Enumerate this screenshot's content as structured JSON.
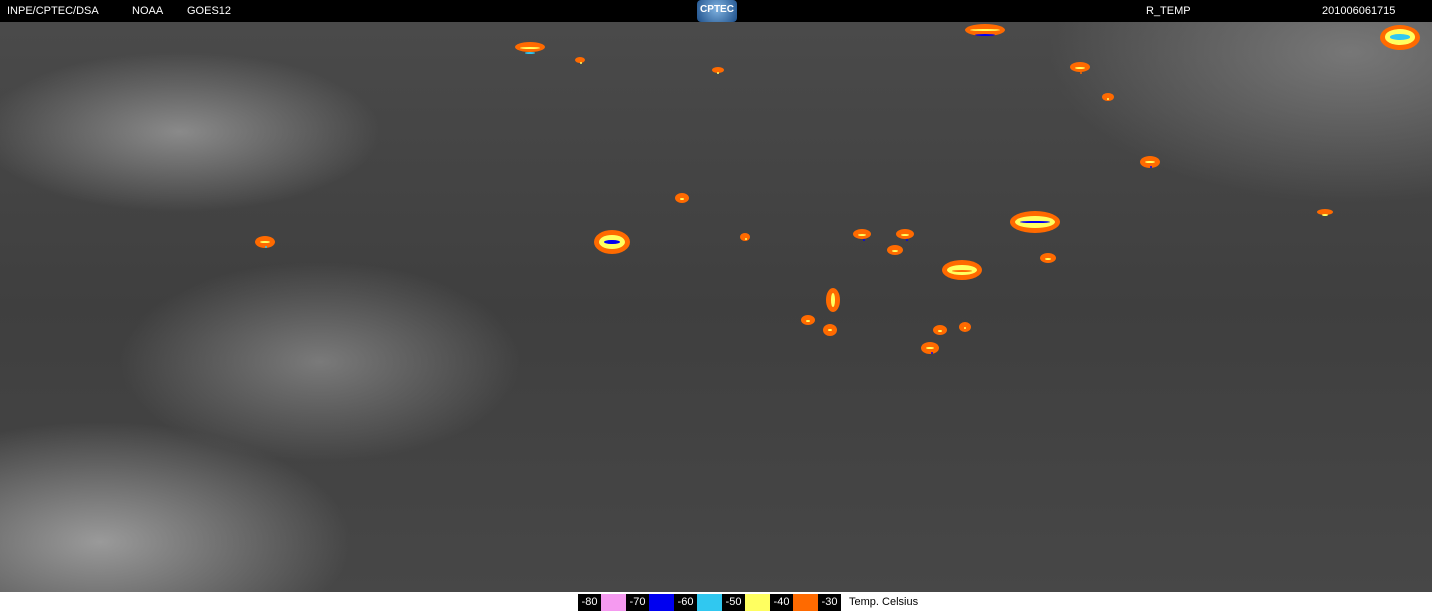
{
  "header": {
    "source": "INPE/CPTEC/DSA",
    "agency": "NOAA",
    "satellite": "GOES12",
    "logo": "CPTEC",
    "product": "R_TEMP",
    "timestamp": "201006061715"
  },
  "legend": {
    "labels": [
      "-80",
      "-70",
      "-60",
      "-50",
      "-40",
      "-30"
    ],
    "colors": [
      "#f59af0",
      "#0000f0",
      "#30c8f0",
      "#ffff60",
      "#ff6a00"
    ],
    "unit": "Temp. Celsius"
  }
}
